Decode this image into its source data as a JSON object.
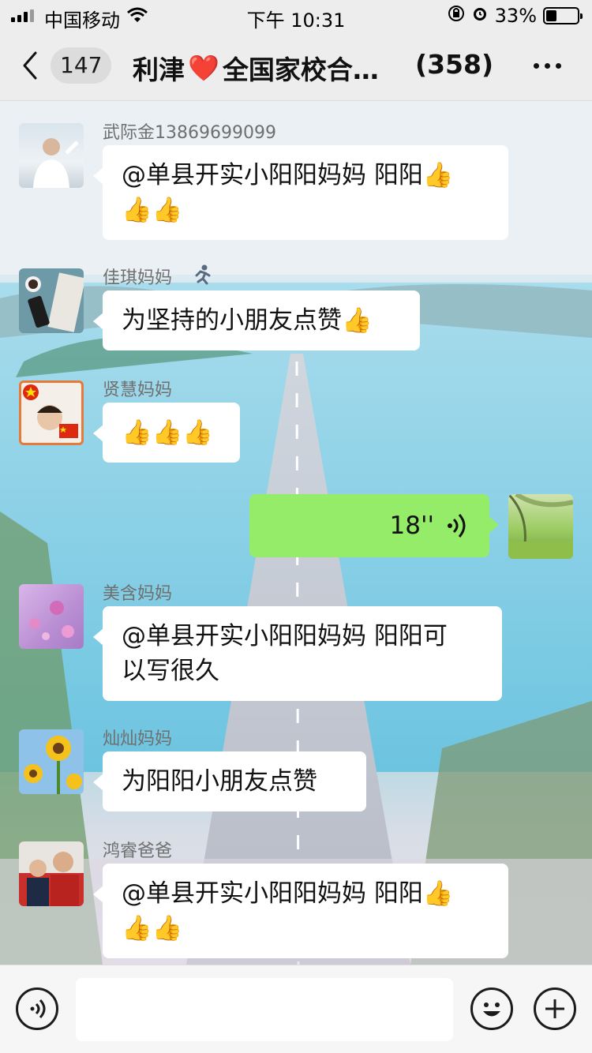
{
  "status_bar": {
    "carrier": "中国移动",
    "time": "下午 10:31",
    "battery_text": "33%",
    "battery_level": 0.33
  },
  "nav": {
    "unread_count": "147",
    "title_left": "利津",
    "title_heart": "❤️",
    "title_right": "全国家校合…",
    "member_count": "(358)"
  },
  "messages": [
    {
      "sender": "武际金13869699099",
      "lines": [
        "@单县开实小阳阳妈妈 阳阳👍",
        "👍👍"
      ],
      "direction": "in",
      "avatar": "man-in-white-shirt"
    },
    {
      "sender": "佳琪妈妈",
      "sender_badge": "runner-icon",
      "lines": [
        "为坚持的小朋友点赞👍"
      ],
      "direction": "in",
      "avatar": "desk-with-phone-and-coffee"
    },
    {
      "sender": "贤慧妈妈",
      "lines": [
        "👍👍👍"
      ],
      "direction": "in",
      "avatar": "child-with-flags"
    },
    {
      "duration": "18''",
      "direction": "out",
      "type": "voice",
      "avatar": "green-landscape"
    },
    {
      "sender": "美含妈妈",
      "lines": [
        "@单县开实小阳阳妈妈 阳阳可",
        "以写很久"
      ],
      "direction": "in",
      "avatar": "purple-flowers"
    },
    {
      "sender": "灿灿妈妈",
      "lines": [
        "为阳阳小朋友点赞"
      ],
      "direction": "in",
      "avatar": "sunflowers"
    },
    {
      "sender": "鸿睿爸爸",
      "lines": [
        "@单县开实小阳阳妈妈 阳阳👍",
        "👍👍"
      ],
      "direction": "in",
      "avatar": "father-and-son"
    }
  ],
  "colors": {
    "outgoing_bubble": "#95ec69",
    "incoming_bubble": "#ffffff",
    "nav_background": "#ededed"
  }
}
